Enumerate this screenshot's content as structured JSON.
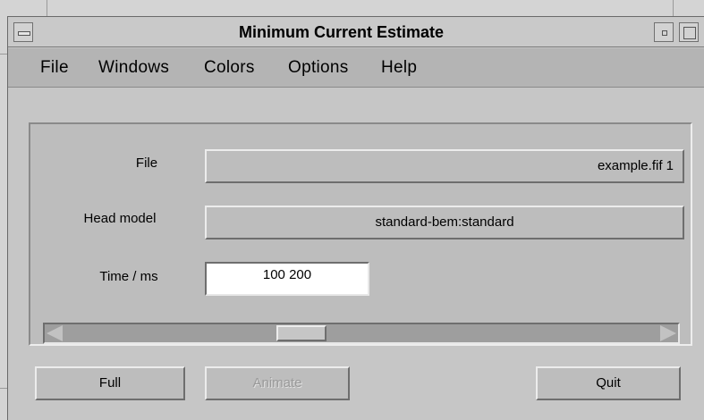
{
  "window": {
    "title": "Minimum Current Estimate"
  },
  "menubar": {
    "items": [
      "File",
      "Windows",
      "Colors",
      "Options",
      "Help"
    ]
  },
  "form": {
    "file_label": "File",
    "file_value": "example.fif 1",
    "head_model_label": "Head model",
    "head_model_value": "standard-bem:standard",
    "time_label": "Time / ms",
    "time_value": "100 200"
  },
  "scrollbar": {
    "position": 0.39
  },
  "buttons": {
    "full": "Full",
    "animate": "Animate",
    "quit": "Quit"
  }
}
